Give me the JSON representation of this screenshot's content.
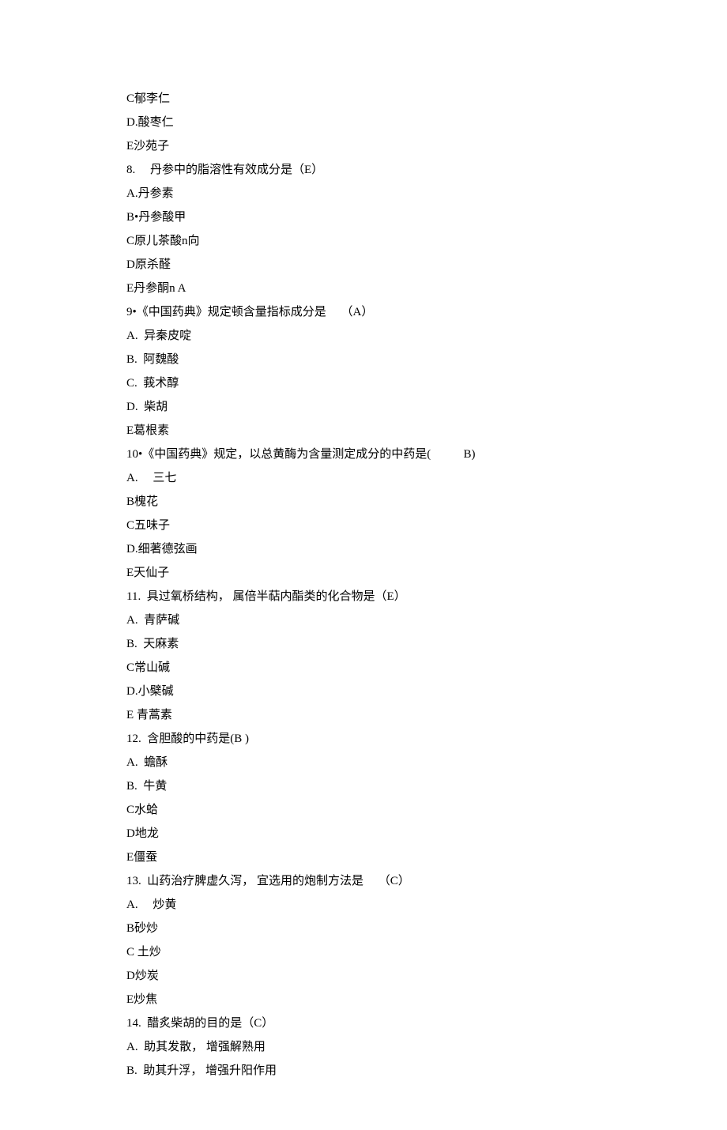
{
  "lines": [
    "C郁李仁",
    "D.酸枣仁",
    "E沙苑子",
    "8.     丹参中的脂溶性有效成分是（E）",
    "A.丹参素",
    "B•丹参酸甲",
    "C原儿茶酸n向",
    "D原杀醛",
    "E丹参酮n A",
    "9•《中国药典》规定顿含量指标成分是     （A）",
    "A.  异秦皮啶",
    "B.  阿魏酸",
    "C.  莪术醇",
    "D.  柴胡",
    "E葛根素",
    "10•《中国药典》规定，以总黄酶为含量测定成分的中药是(           B)",
    "A.     三七",
    "B槐花",
    "C五味子",
    "D.细著德弦画",
    "E天仙子",
    "11.  具过氧桥结构， 属倍半萜内酯类的化合物是（E）",
    "A.  青萨碱",
    "B.  天麻素",
    "C常山碱",
    "D.小檗碱",
    "E 青蒿素",
    "12.  含胆酸的中药是(B )",
    "A.  蟾酥",
    "B.  牛黄",
    "C水蛤",
    "D地龙",
    "E僵蚕",
    "13.  山药治疗脾虚久泻， 宜选用的炮制方法是     （C）",
    "A.     炒黄",
    "B砂炒",
    "C 土炒",
    "D炒炭",
    "E炒焦",
    "14.  醋炙柴胡的目的是（C）",
    "A.  助其发散， 增强解熟用",
    "B.  助其升浮， 增强升阳作用"
  ]
}
